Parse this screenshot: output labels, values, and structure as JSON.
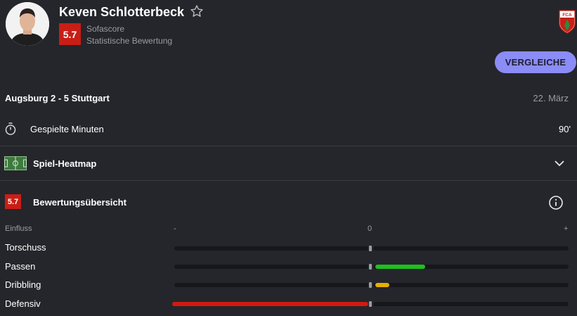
{
  "player": {
    "name": "Keven Schlotterbeck",
    "rating": "5.7",
    "source": "Sofascore",
    "rating_type": "Statistische Bewertung"
  },
  "club_logo_text": "FCA",
  "compare_button": "VERGLEICHE",
  "match": {
    "title": "Augsburg 2 - 5 Stuttgart",
    "date": "22. März"
  },
  "minutes": {
    "label": "Gespielte Minuten",
    "value": "90'"
  },
  "heatmap": {
    "label": "Spiel-Heatmap"
  },
  "rating_overview": {
    "rating": "5.7",
    "label": "Bewertungsübersicht"
  },
  "influence": {
    "header": "Einfluss",
    "axis_minus": "-",
    "axis_zero": "0",
    "axis_plus": "+",
    "stats": [
      {
        "label": "Torschuss",
        "value": 0,
        "color": "#9a9ca3"
      },
      {
        "label": "Passen",
        "value": 0.25,
        "color": "#1ec11e"
      },
      {
        "label": "Dribbling",
        "value": 0.07,
        "color": "#e6b000"
      },
      {
        "label": "Defensiv",
        "value": -1.0,
        "color": "#d11a10"
      }
    ]
  },
  "colors": {
    "background": "#24262b",
    "accent": "#8b8cf5",
    "rating_red": "#c81e16"
  }
}
